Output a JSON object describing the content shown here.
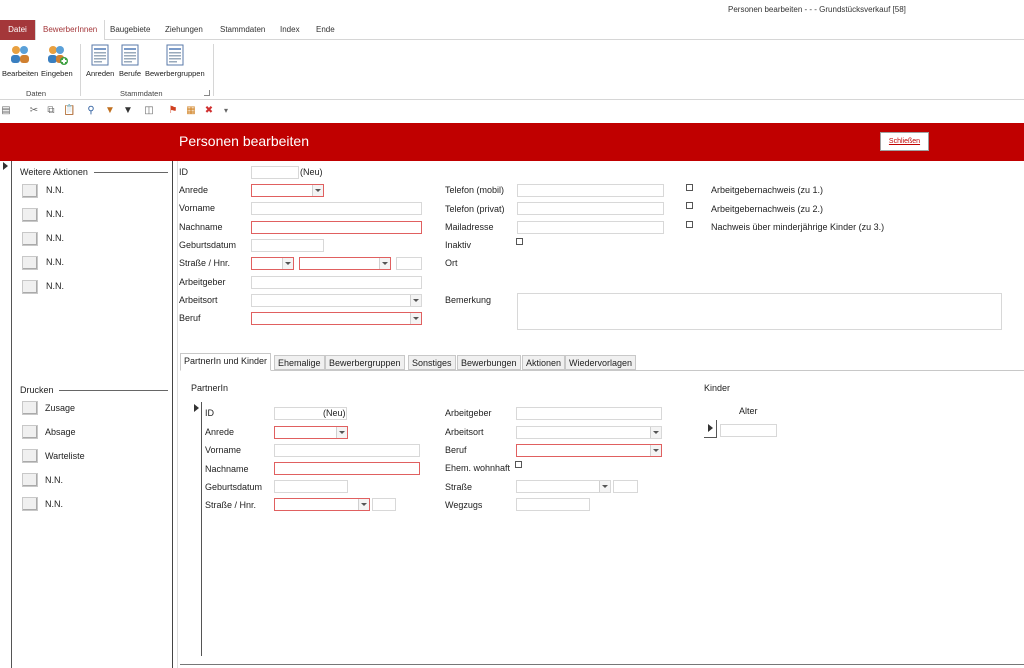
{
  "window": {
    "title": "Personen bearbeiten - - - Grundstücksverkauf [58]"
  },
  "ribbon_tabs": [
    "Datei",
    "BewerberInnen",
    "Baugebiete",
    "Ziehungen",
    "Stammdaten",
    "Index",
    "Ende"
  ],
  "ribbon": {
    "group_daten": {
      "label": "Daten",
      "buttons": [
        "Bearbeiten",
        "Eingeben"
      ]
    },
    "group_stammdaten": {
      "label": "Stammdaten",
      "buttons": [
        "Anreden",
        "Berufe",
        "Bewerbergruppen"
      ]
    }
  },
  "form": {
    "title": "Personen bearbeiten",
    "close_label": "Schließen"
  },
  "left": {
    "weitere_title": "Weitere Aktionen",
    "weitere_items": [
      "N.N.",
      "N.N.",
      "N.N.",
      "N.N.",
      "N.N."
    ],
    "drucken_title": "Drucken",
    "drucken_items": [
      "Zusage",
      "Absage",
      "Warteliste",
      "N.N.",
      "N.N."
    ]
  },
  "person": {
    "labels": {
      "id": "ID",
      "anrede": "Anrede",
      "vorname": "Vorname",
      "nachname": "Nachname",
      "geburtsdatum": "Geburtsdatum",
      "strasse": "Straße / Hnr.",
      "arbeitgeber": "Arbeitgeber",
      "arbeitsort": "Arbeitsort",
      "beruf": "Beruf",
      "tel_mobil": "Telefon (mobil)",
      "tel_privat": "Telefon (privat)",
      "mail": "Mailadresse",
      "inaktiv": "Inaktiv",
      "ort": "Ort",
      "bemerkung": "Bemerkung",
      "nachweis1": "Arbeitgebernachweis (zu 1.)",
      "nachweis2": "Arbeitgebernachweis (zu 2.)",
      "nachweis3": "Nachweis über minderjährige Kinder (zu 3.)"
    },
    "id_value": "(Neu)"
  },
  "subtabs": [
    "PartnerIn und Kinder",
    "Ehemalige",
    "Bewerbergruppen",
    "Sonstiges",
    "Bewerbungen",
    "Aktionen",
    "Wiedervorlagen"
  ],
  "partner": {
    "title": "PartnerIn",
    "labels": {
      "id": "ID",
      "anrede": "Anrede",
      "vorname": "Vorname",
      "nachname": "Nachname",
      "geburtsdatum": "Geburtsdatum",
      "strasse": "Straße / Hnr.",
      "arbeitgeber": "Arbeitgeber",
      "arbeitsort": "Arbeitsort",
      "beruf": "Beruf",
      "ehem": "Ehem. wohnhaft",
      "strasse2": "Straße",
      "wegzugs": "Wegzugs"
    },
    "id_value": "(Neu)"
  },
  "kinder": {
    "title": "Kinder",
    "alter_label": "Alter"
  },
  "colors": {
    "accent": "#c00000",
    "file_tab": "#a4373a"
  }
}
